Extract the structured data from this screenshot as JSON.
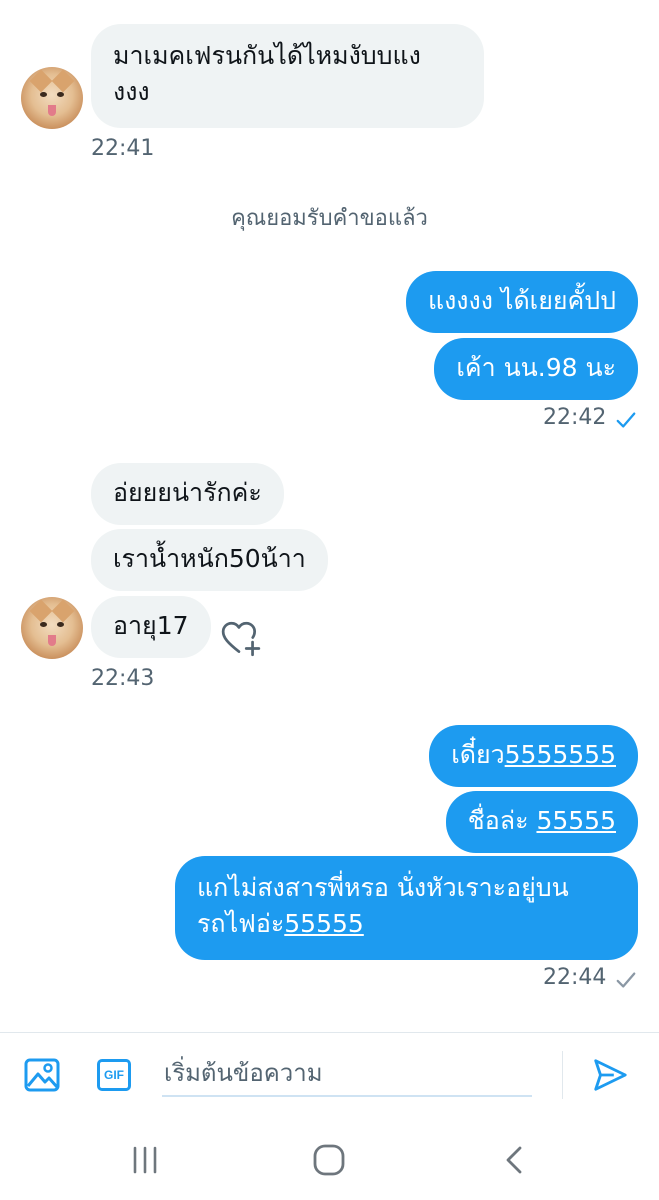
{
  "messages": {
    "m1": {
      "text_line1": "มาเมคเฟรนกันได้ไหมงับบแง",
      "text_line2": "งงง",
      "time": "22:41"
    },
    "system_notice": "คุณยอมรับคำขอแล้ว",
    "m2": "แงงงง ได้เยยคั้ปป",
    "m3": "เค้า นน.98 นะ",
    "time2": "22:42",
    "m4": "อ่ยยยน่ารักค่ะ",
    "m5": "เราน้ำหนัก50น้าา",
    "m6": "อายุ17",
    "time3": "22:43",
    "m7": {
      "prefix": "เดี๋ยว",
      "link": "5555555"
    },
    "m8": {
      "prefix": "ชื่อล่ะ ",
      "link": "55555"
    },
    "m9": {
      "line1": "แกไม่สงสารพี่หรอ นั่งหัวเราะอยู่บน",
      "line2_prefix": "รถไฟอ่ะ",
      "line2_link": "55555"
    },
    "time4": "22:44"
  },
  "composer": {
    "placeholder": "เริ่มต้นข้อความ",
    "gif_label": "GIF"
  },
  "icons": {
    "image": "image-icon",
    "gif": "gif-icon",
    "send": "send-icon",
    "react": "heart-plus-icon",
    "read_receipt": "check-icon",
    "nav_recents": "recents-icon",
    "nav_home": "home-icon",
    "nav_back": "back-icon"
  },
  "colors": {
    "accent": "#1d9bf0",
    "incoming_bubble": "#eff3f4",
    "secondary_text": "#536471"
  }
}
